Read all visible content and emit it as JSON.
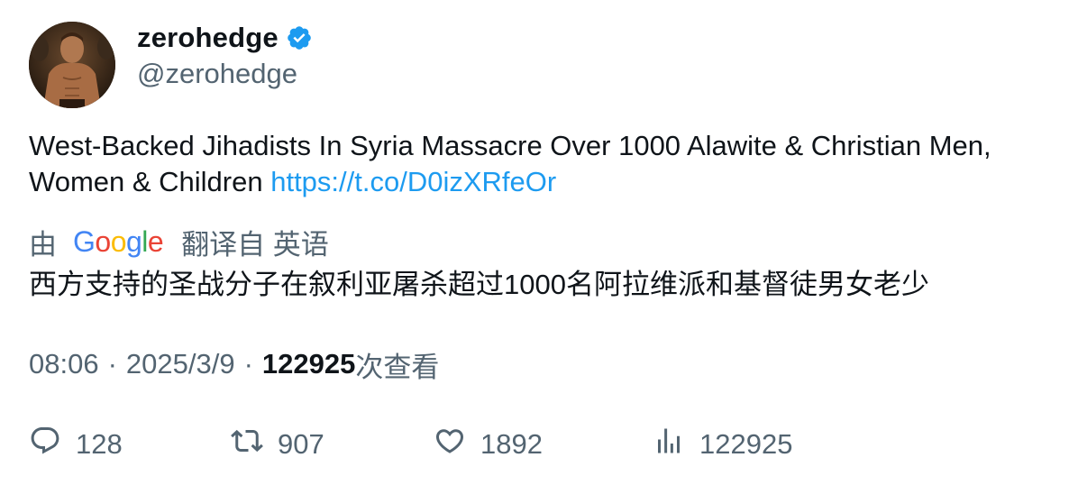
{
  "author": {
    "display_name": "zerohedge",
    "handle": "@zerohedge",
    "verified": true,
    "verified_color": "#1d9bf0"
  },
  "post": {
    "text": "West-Backed Jihadists In Syria Massacre Over 1000 Alawite & Christian Men, Women & Children ",
    "link": "https://t.co/D0izXRfeOr",
    "link_color": "#1d9bf0"
  },
  "translation": {
    "prefix": "由",
    "provider": "Google",
    "suffix": "翻译自 英语",
    "text": "西方支持的圣战分子在叙利亚屠杀超过1000名阿拉维派和基督徒男女老少"
  },
  "meta": {
    "time": "08:06",
    "separator": "·",
    "date": "2025/3/9",
    "views_count": "122925",
    "views_label": "次查看"
  },
  "actions": {
    "reply": {
      "icon": "reply-icon",
      "count": "128"
    },
    "retweet": {
      "icon": "retweet-icon",
      "count": "907"
    },
    "like": {
      "icon": "heart-icon",
      "count": "1892"
    },
    "views": {
      "icon": "analytics-icon",
      "count": "122925"
    }
  },
  "colors": {
    "text_primary": "#0f1419",
    "text_secondary": "#536471"
  }
}
